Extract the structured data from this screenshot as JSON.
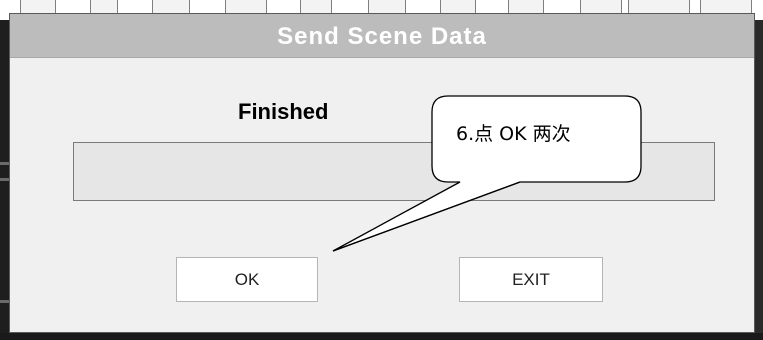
{
  "dialog": {
    "title": "Send Scene Data",
    "status": "Finished",
    "progress_fraction": 1.0
  },
  "buttons": {
    "ok_label": "OK",
    "exit_label": "EXIT"
  },
  "annotation": {
    "text": "6.点 OK 两次"
  },
  "colors": {
    "titlebar": "#bcbcbc",
    "dialog_bg": "#f0f0f0",
    "title_text": "#ffffff"
  }
}
